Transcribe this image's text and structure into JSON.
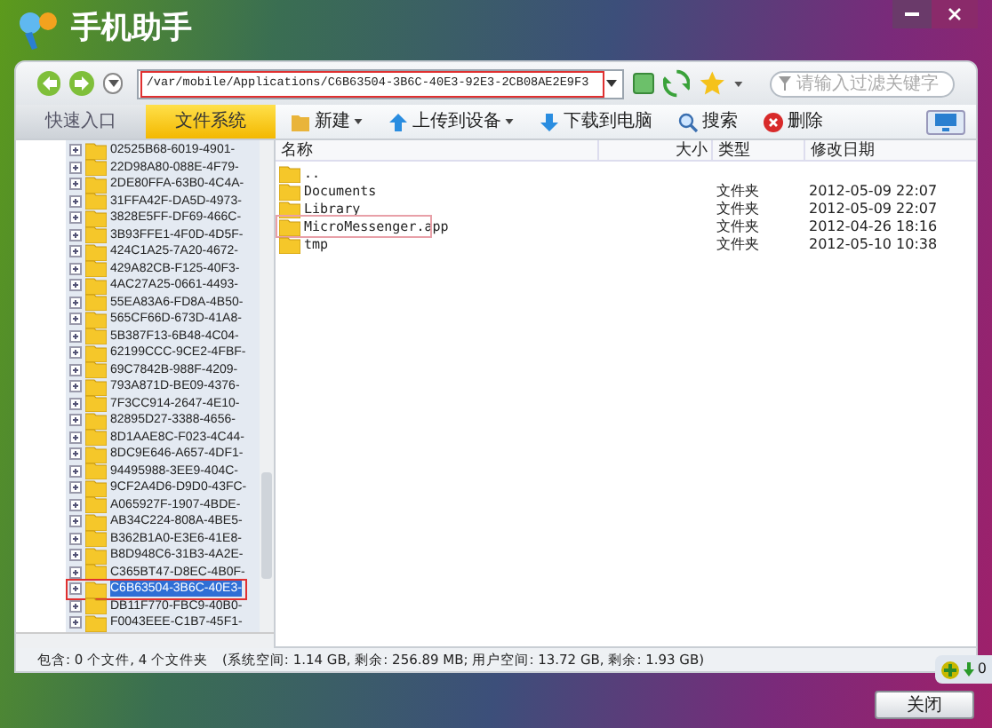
{
  "window": {
    "title": "手机助手"
  },
  "address": {
    "path": "/var/mobile/Applications/C6B63504-3B6C-40E3-92E3-2CB08AE2E9F3",
    "highlighted": true
  },
  "search": {
    "placeholder": "请输入过滤关键字"
  },
  "tabs": [
    {
      "label": "快速入口",
      "selected": false
    },
    {
      "label": "文件系统",
      "selected": true
    }
  ],
  "toolbar": [
    {
      "label": "新建",
      "kind": "new",
      "dropdown": true
    },
    {
      "label": "上传到设备",
      "kind": "upload",
      "dropdown": true
    },
    {
      "label": "下载到电脑",
      "kind": "download",
      "dropdown": false
    },
    {
      "label": "搜索",
      "kind": "search",
      "dropdown": false
    },
    {
      "label": "删除",
      "kind": "delete",
      "dropdown": false
    }
  ],
  "tree": [
    {
      "name": "02525B68-6019-4901-",
      "selected": false
    },
    {
      "name": "22D98A80-088E-4F79-",
      "selected": false
    },
    {
      "name": "2DE80FFA-63B0-4C4A-",
      "selected": false
    },
    {
      "name": "31FFA42F-DA5D-4973-",
      "selected": false
    },
    {
      "name": "3828E5FF-DF69-466C-",
      "selected": false
    },
    {
      "name": "3B93FFE1-4F0D-4D5F-",
      "selected": false
    },
    {
      "name": "424C1A25-7A20-4672-",
      "selected": false
    },
    {
      "name": "429A82CB-F125-40F3-",
      "selected": false
    },
    {
      "name": "4AC27A25-0661-4493-",
      "selected": false
    },
    {
      "name": "55EA83A6-FD8A-4B50-",
      "selected": false
    },
    {
      "name": "565CF66D-673D-41A8-",
      "selected": false
    },
    {
      "name": "5B387F13-6B48-4C04-",
      "selected": false
    },
    {
      "name": "62199CCC-9CE2-4FBF-",
      "selected": false
    },
    {
      "name": "69C7842B-988F-4209-",
      "selected": false
    },
    {
      "name": "793A871D-BE09-4376-",
      "selected": false
    },
    {
      "name": "7F3CC914-2647-4E10-",
      "selected": false
    },
    {
      "name": "82895D27-3388-4656-",
      "selected": false
    },
    {
      "name": "8D1AAE8C-F023-4C44-",
      "selected": false
    },
    {
      "name": "8DC9E646-A657-4DF1-",
      "selected": false
    },
    {
      "name": "94495988-3EE9-404C-",
      "selected": false
    },
    {
      "name": "9CF2A4D6-D9D0-43FC-",
      "selected": false
    },
    {
      "name": "A065927F-1907-4BDE-",
      "selected": false
    },
    {
      "name": "AB34C224-808A-4BE5-",
      "selected": false
    },
    {
      "name": "B362B1A0-E3E6-41E8-",
      "selected": false
    },
    {
      "name": "B8D948C6-31B3-4A2E-",
      "selected": false
    },
    {
      "name": "C365BT47-D8EC-4B0F-",
      "selected": false
    },
    {
      "name": "C6B63504-3B6C-40E3-",
      "selected": true
    },
    {
      "name": "DB11F770-FBC9-40B0-",
      "selected": false
    },
    {
      "name": "F0043EEE-C1B7-45F1-",
      "selected": false
    }
  ],
  "table": {
    "columns": [
      "名称",
      "大小",
      "类型",
      "修改日期"
    ],
    "rows": [
      {
        "name": "..",
        "type": "",
        "modified": "",
        "highlighted": false
      },
      {
        "name": "Documents",
        "type": "文件夹",
        "modified": "2012-05-09 22:07",
        "highlighted": false
      },
      {
        "name": "Library",
        "type": "文件夹",
        "modified": "2012-05-09 22:07",
        "highlighted": false
      },
      {
        "name": "MicroMessenger.app",
        "type": "文件夹",
        "modified": "2012-04-26 18:16",
        "highlighted": true
      },
      {
        "name": "tmp",
        "type": "文件夹",
        "modified": "2012-05-10 10:38",
        "highlighted": false
      }
    ]
  },
  "status_bar": "包含: 0 个文件, 4 个文件夹　(系统空间: 1.14 GB, 剩余: 256.89 MB; 用户空间: 13.72 GB, 剩余: 1.93 GB)",
  "tray": {
    "count": "0"
  },
  "buttons": [
    "关闭"
  ]
}
